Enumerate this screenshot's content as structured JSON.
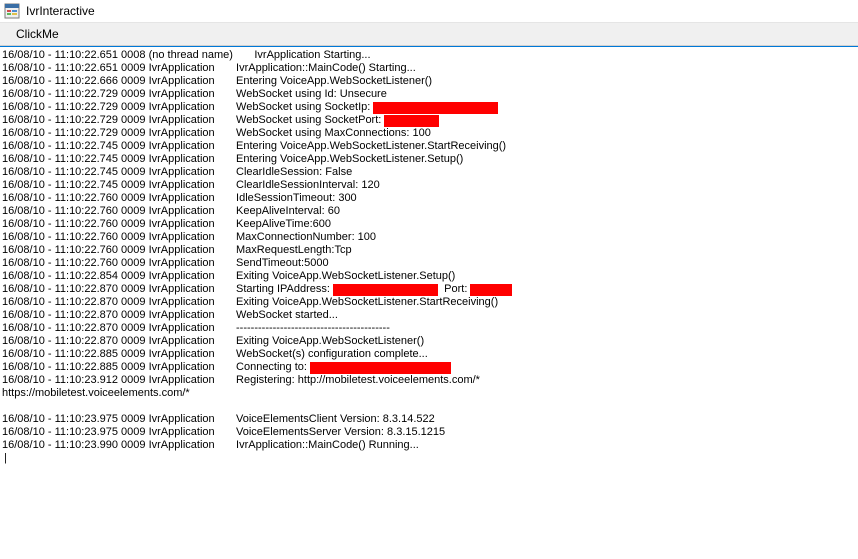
{
  "window": {
    "title": "IvrInteractive"
  },
  "menubar": {
    "clickme": "ClickMe"
  },
  "log_prefix_pad": "       ",
  "log": [
    {
      "ts": "16/08/10 - 11:10:22.651 0008 (no thread name)",
      "msg": "IvrApplication Starting..."
    },
    {
      "ts": "16/08/10 - 11:10:22.651 0009 IvrApplication",
      "msg": "IvrApplication::MainCode() Starting..."
    },
    {
      "ts": "16/08/10 - 11:10:22.666 0009 IvrApplication",
      "msg": "Entering VoiceApp.WebSocketListener()"
    },
    {
      "ts": "16/08/10 - 11:10:22.729 0009 IvrApplication",
      "msg": "WebSocket using Id: Unsecure"
    },
    {
      "ts": "16/08/10 - 11:10:22.729 0009 IvrApplication",
      "msg": "WebSocket using SocketIp: ",
      "redact_w": 125
    },
    {
      "ts": "16/08/10 - 11:10:22.729 0009 IvrApplication",
      "msg": "WebSocket using SocketPort: ",
      "redact_w": 55
    },
    {
      "ts": "16/08/10 - 11:10:22.729 0009 IvrApplication",
      "msg": "WebSocket using MaxConnections: 100"
    },
    {
      "ts": "16/08/10 - 11:10:22.745 0009 IvrApplication",
      "msg": "Entering VoiceApp.WebSocketListener.StartReceiving()"
    },
    {
      "ts": "16/08/10 - 11:10:22.745 0009 IvrApplication",
      "msg": "Entering VoiceApp.WebSocketListener.Setup()"
    },
    {
      "ts": "16/08/10 - 11:10:22.745 0009 IvrApplication",
      "msg": "ClearIdleSession: False"
    },
    {
      "ts": "16/08/10 - 11:10:22.745 0009 IvrApplication",
      "msg": "ClearIdleSessionInterval: 120"
    },
    {
      "ts": "16/08/10 - 11:10:22.760 0009 IvrApplication",
      "msg": "IdleSessionTimeout: 300"
    },
    {
      "ts": "16/08/10 - 11:10:22.760 0009 IvrApplication",
      "msg": "KeepAliveInterval: 60"
    },
    {
      "ts": "16/08/10 - 11:10:22.760 0009 IvrApplication",
      "msg": "KeepAliveTime:600"
    },
    {
      "ts": "16/08/10 - 11:10:22.760 0009 IvrApplication",
      "msg": "MaxConnectionNumber: 100"
    },
    {
      "ts": "16/08/10 - 11:10:22.760 0009 IvrApplication",
      "msg": "MaxRequestLength:Tcp"
    },
    {
      "ts": "16/08/10 - 11:10:22.760 0009 IvrApplication",
      "msg": "SendTimeout:5000"
    },
    {
      "ts": "16/08/10 - 11:10:22.854 0009 IvrApplication",
      "msg": "Exiting VoiceApp.WebSocketListener.Setup()"
    },
    {
      "ts": "16/08/10 - 11:10:22.870 0009 IvrApplication",
      "msg": "Starting IPAddress: ",
      "redact_w": 105,
      "msg2": "  Port: ",
      "redact2_w": 42
    },
    {
      "ts": "16/08/10 - 11:10:22.870 0009 IvrApplication",
      "msg": "Exiting VoiceApp.WebSocketListener.StartReceiving()"
    },
    {
      "ts": "16/08/10 - 11:10:22.870 0009 IvrApplication",
      "msg": "WebSocket started..."
    },
    {
      "ts": "16/08/10 - 11:10:22.870 0009 IvrApplication",
      "msg": "------------------------------------------"
    },
    {
      "ts": "16/08/10 - 11:10:22.870 0009 IvrApplication",
      "msg": "Exiting VoiceApp.WebSocketListener()"
    },
    {
      "ts": "16/08/10 - 11:10:22.885 0009 IvrApplication",
      "msg": "WebSocket(s) configuration complete..."
    },
    {
      "ts": "16/08/10 - 11:10:22.885 0009 IvrApplication",
      "msg": "Connecting to: ",
      "redact_w": 141
    },
    {
      "ts": "16/08/10 - 11:10:23.912 0009 IvrApplication",
      "msg": "Registering: http://mobiletest.voiceelements.com/*"
    },
    {
      "raw": "https://mobiletest.voiceelements.com/*"
    },
    {
      "raw": " "
    },
    {
      "ts": "16/08/10 - 11:10:23.975 0009 IvrApplication",
      "msg": "VoiceElementsClient Version: 8.3.14.522"
    },
    {
      "ts": "16/08/10 - 11:10:23.975 0009 IvrApplication",
      "msg": "VoiceElementsServer Version: 8.3.15.1215"
    },
    {
      "ts": "16/08/10 - 11:10:23.990 0009 IvrApplication",
      "msg": "IvrApplication::MainCode() Running..."
    }
  ],
  "cursor": "|"
}
